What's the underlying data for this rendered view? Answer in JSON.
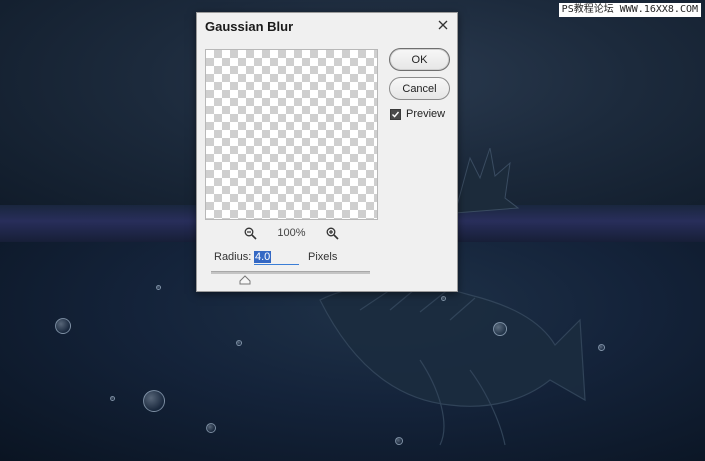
{
  "watermark": "PS教程论坛 WWW.16XX8.COM",
  "dialog": {
    "title": "Gaussian Blur",
    "ok_label": "OK",
    "cancel_label": "Cancel",
    "preview_label": "Preview",
    "preview_checked": true,
    "zoom_level": "100%",
    "radius_label": "Radius:",
    "radius_value": "4.0",
    "units_label": "Pixels"
  },
  "icons": {
    "close": "close-icon",
    "zoom_out": "zoom-out-icon",
    "zoom_in": "zoom-in-icon",
    "check": "check-icon",
    "slider": "slider-thumb-icon"
  }
}
